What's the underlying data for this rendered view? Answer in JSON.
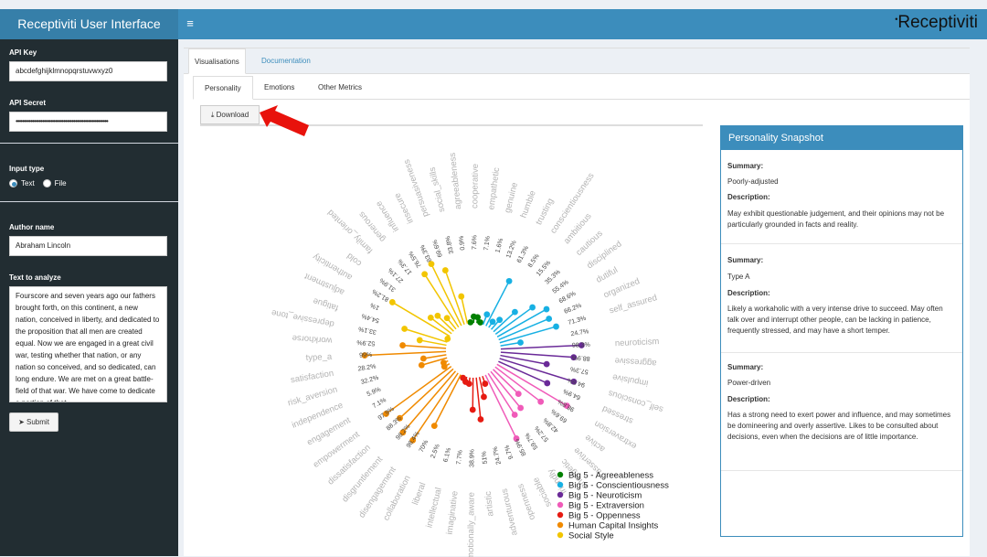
{
  "header": {
    "app_title": "Receptiviti User Interface",
    "brand_logo": "Receptiviti",
    "hamburger_icon": "≡"
  },
  "sidebar": {
    "api_key_label": "API Key",
    "api_key_value": "abcdefghijklmnopqrstuvwxyz0",
    "api_secret_label": "API Secret",
    "api_secret_value": "••••••••••••••••••••••••••••••••••••••••••••••••••••••••",
    "input_type_label": "Input type",
    "input_options": [
      {
        "label": "Text",
        "checked": true
      },
      {
        "label": "File",
        "checked": false
      }
    ],
    "author_name_label": "Author name",
    "author_name_value": "Abraham Lincoln",
    "text_label": "Text to analyze",
    "text_value": "Fourscore and seven years ago our fathers brought forth, on this continent, a new nation, conceived in liberty, and dedicated to the proposition that all men are created equal. Now we are engaged in a great civil war, testing whether that nation, or any nation so conceived, and so dedicated, can long endure. We are met on a great battle-field of that war. We have come to dedicate a portion of that",
    "submit_label": "Submit"
  },
  "tabs": [
    {
      "label": "Visualisations",
      "active": true
    },
    {
      "label": "Documentation",
      "active": false
    }
  ],
  "sub_tabs": [
    {
      "label": "Personality",
      "active": true
    },
    {
      "label": "Emotions",
      "active": false
    },
    {
      "label": "Other Metrics",
      "active": false
    }
  ],
  "download_label": "Download",
  "annotation": {
    "color": "#e8120c"
  },
  "snapshot": {
    "title": "Personality Snapshot",
    "summary_label": "Summary:",
    "description_label": "Description:",
    "items": [
      {
        "summary": "Poorly-adjusted",
        "description": "May exhibit questionable judgement, and their opinions may not be particularly grounded in facts and reality."
      },
      {
        "summary": "Type A",
        "description": "Likely a workaholic with a very intense drive to succeed. May often talk over and interrupt other people, can be lacking in patience, frequently stressed, and may have a short temper."
      },
      {
        "summary": "Power-driven",
        "description": "Has a strong need to exert power and influence, and may sometimes be domineering and overly assertive. Likes to be consulted about decisions, even when the decisions are of little importance."
      }
    ]
  },
  "chart_data": {
    "type": "radial-lollipop",
    "series": [
      {
        "name": "Big 5 - Agreeableness",
        "color": "#008000",
        "items": [
          {
            "label": "agreeableness",
            "value": 0.9
          },
          {
            "label": "cooperative",
            "value": 7.6
          },
          {
            "label": "empathetic",
            "value": 7.1
          },
          {
            "label": "genuine",
            "value": 1.6
          }
        ]
      },
      {
        "name": "Big 5 - Conscientiousness",
        "color": "#17b0e3",
        "items": [
          {
            "label": "humble",
            "value": 13.2
          },
          {
            "label": "trusting",
            "value": 61.3
          },
          {
            "label": "conscientiousness",
            "value": 8.5
          },
          {
            "label": "ambitious",
            "value": 15.5
          },
          {
            "label": "cautious",
            "value": 35.3
          },
          {
            "label": "disciplined",
            "value": 55.4
          },
          {
            "label": "dutiful",
            "value": 68.6
          },
          {
            "label": "organized",
            "value": 66.2
          },
          {
            "label": "self_assured",
            "value": 71.3
          },
          {
            "label": "",
            "value": 24.7
          }
        ]
      },
      {
        "name": "Big 5 - Neuroticism",
        "color": "#6a2a98",
        "items": [
          {
            "label": "neuroticism",
            "value": 98.3
          },
          {
            "label": "aggressive",
            "value": 88.9
          },
          {
            "label": "impulsive",
            "value": 57.3
          },
          {
            "label": "self_conscious",
            "value": 94.5
          },
          {
            "label": "stressed",
            "value": 64.9
          }
        ]
      },
      {
        "name": "Big 5 - Extraversion",
        "color": "#f05bb9",
        "items": [
          {
            "label": "extraversion",
            "value": 98.8
          },
          {
            "label": "active",
            "value": 69.6
          },
          {
            "label": "assertive",
            "value": 42.8
          },
          {
            "label": "energetic",
            "value": 57.2
          },
          {
            "label": "friendly",
            "value": 59.7
          },
          {
            "label": "sociable",
            "value": 85.9
          }
        ]
      },
      {
        "name": "Big 5 - Oppenness",
        "color": "#e61b12",
        "items": [
          {
            "label": "openness",
            "value": 9.7
          },
          {
            "label": "adventurous",
            "value": 24.7
          },
          {
            "label": "artistic",
            "value": 51
          },
          {
            "label": "emotionally_aware",
            "value": 38.9
          },
          {
            "label": "imaginative",
            "value": 7.7
          },
          {
            "label": "intellectual",
            "value": 6.1
          },
          {
            "label": "liberal",
            "value": 2.5
          }
        ]
      },
      {
        "name": "Human Capital Insights",
        "color": "#f08a00",
        "items": [
          {
            "label": "collaboration",
            "value": 70
          },
          {
            "label": "disengagement",
            "value": 98.4
          },
          {
            "label": "disgruntlement",
            "value": 98.2
          },
          {
            "label": "dissatisfaction",
            "value": 88.3
          },
          {
            "label": "empowerment",
            "value": 97.9
          },
          {
            "label": "engagement",
            "value": 7.1
          },
          {
            "label": "independence",
            "value": 5.9
          },
          {
            "label": "risk_aversion",
            "value": 32.2
          },
          {
            "label": "satisfaction",
            "value": 28.2
          },
          {
            "label": "type_a",
            "value": 99
          },
          {
            "label": "workhorse",
            "value": 52.9
          }
        ]
      },
      {
        "name": "Social Style",
        "color": "#f2c500",
        "items": [
          {
            "label": "depressive_tone",
            "value": 33.1
          },
          {
            "label": "fatigue",
            "value": 54.4
          },
          {
            "label": "adjustment",
            "value": 1
          },
          {
            "label": "authenticity",
            "value": 81.2
          },
          {
            "label": "cold",
            "value": 31.9
          },
          {
            "label": "family_oriented",
            "value": 27.1
          },
          {
            "label": "generous",
            "value": 17.3
          },
          {
            "label": "influence",
            "value": 76.5
          },
          {
            "label": "insecure",
            "value": 83.3
          },
          {
            "label": "persuasiveness",
            "value": 69.6
          },
          {
            "label": "social_skills",
            "value": 33.8
          }
        ]
      }
    ]
  }
}
